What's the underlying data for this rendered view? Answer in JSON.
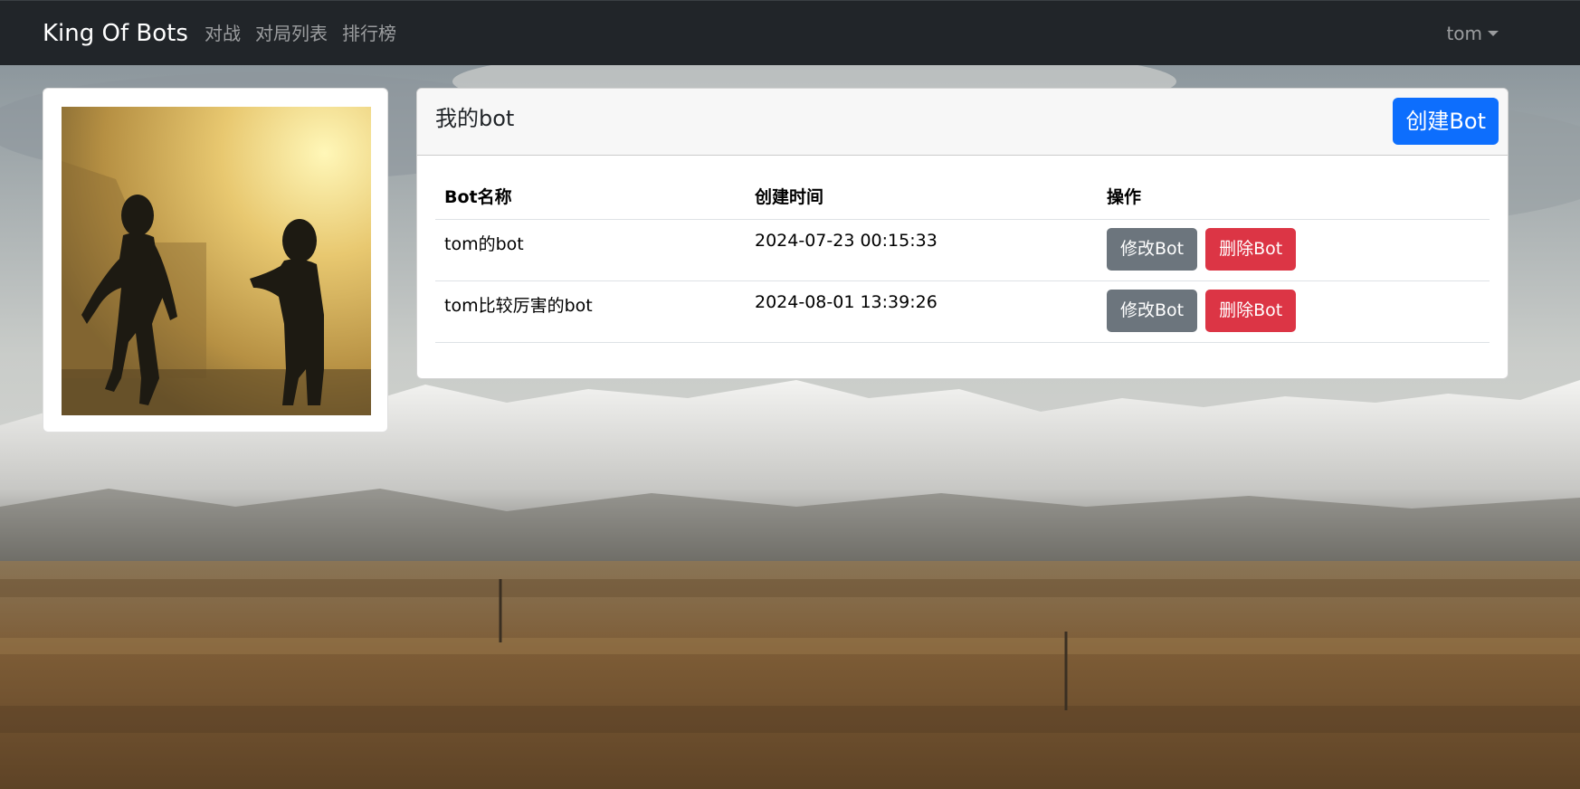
{
  "navbar": {
    "brand": "King Of Bots",
    "links": [
      "对战",
      "对局列表",
      "排行榜"
    ],
    "username": "tom"
  },
  "avatar": {
    "alt": "user avatar"
  },
  "bots_panel": {
    "title": "我的bot",
    "create_button": "创建Bot",
    "columns": [
      "Bot名称",
      "创建时间",
      "操作"
    ],
    "rows": [
      {
        "name": "tom的bot",
        "created": "2024-07-23 00:15:33",
        "edit": "修改Bot",
        "delete": "删除Bot"
      },
      {
        "name": "tom比较厉害的bot",
        "created": "2024-08-01 13:39:26",
        "edit": "修改Bot",
        "delete": "删除Bot"
      }
    ]
  },
  "colors": {
    "navbar": "#212529",
    "primary": "#0d6efd",
    "secondary": "#6c757d",
    "danger": "#dc3545"
  }
}
